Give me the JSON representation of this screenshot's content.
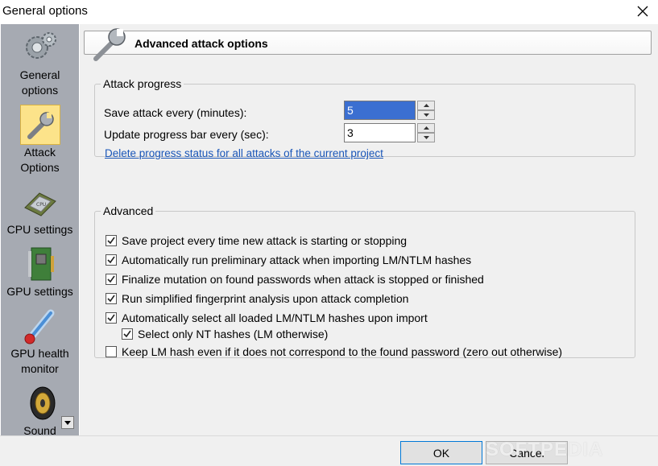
{
  "window": {
    "title": "General options"
  },
  "sidebar": {
    "items": [
      {
        "label1": "General",
        "label2": "options",
        "icon": "gears-icon"
      },
      {
        "label1": "Attack",
        "label2": "Options",
        "icon": "wrench-icon",
        "selected": true
      },
      {
        "label1": "CPU settings",
        "label2": "",
        "icon": "cpu-chip-icon"
      },
      {
        "label1": "GPU settings",
        "label2": "",
        "icon": "gpu-card-icon"
      },
      {
        "label1": "GPU health",
        "label2": "monitor",
        "icon": "thermometer-icon"
      },
      {
        "label1": "Sound",
        "label2": "",
        "icon": "speaker-icon"
      }
    ]
  },
  "header": {
    "title": "Advanced attack options",
    "icon": "wrench-icon"
  },
  "attack_progress": {
    "legend": "Attack progress",
    "save_label": "Save attack every (minutes):",
    "save_value": "5",
    "update_label": "Update progress bar every (sec):",
    "update_value": "3",
    "delete_link": "Delete progress status for all attacks of the current project"
  },
  "advanced": {
    "legend": "Advanced",
    "options": [
      {
        "label": "Save project every time new attack is starting or stopping",
        "checked": true
      },
      {
        "label": "Automatically run preliminary attack when importing LM/NTLM hashes",
        "checked": true
      },
      {
        "label": "Finalize mutation on found passwords when attack is stopped or finished",
        "checked": true
      },
      {
        "label": "Run simplified fingerprint analysis upon attack completion",
        "checked": true
      },
      {
        "label": "Automatically select all loaded LM/NTLM hashes upon import",
        "checked": true
      },
      {
        "label": "Select only NT hashes (LM otherwise)",
        "checked": true
      },
      {
        "label": "Keep LM hash even if it does not correspond to the found password (zero out otherwise)",
        "checked": false
      }
    ]
  },
  "footer": {
    "ok_label": "OK",
    "cancel_label": "Cancel",
    "watermark": "SOFTPEDIA"
  },
  "colors": {
    "sidebar_bg": "#a6aab2",
    "selected_item": "#fce38a",
    "link": "#1a56b8",
    "accent": "#0078d7"
  }
}
